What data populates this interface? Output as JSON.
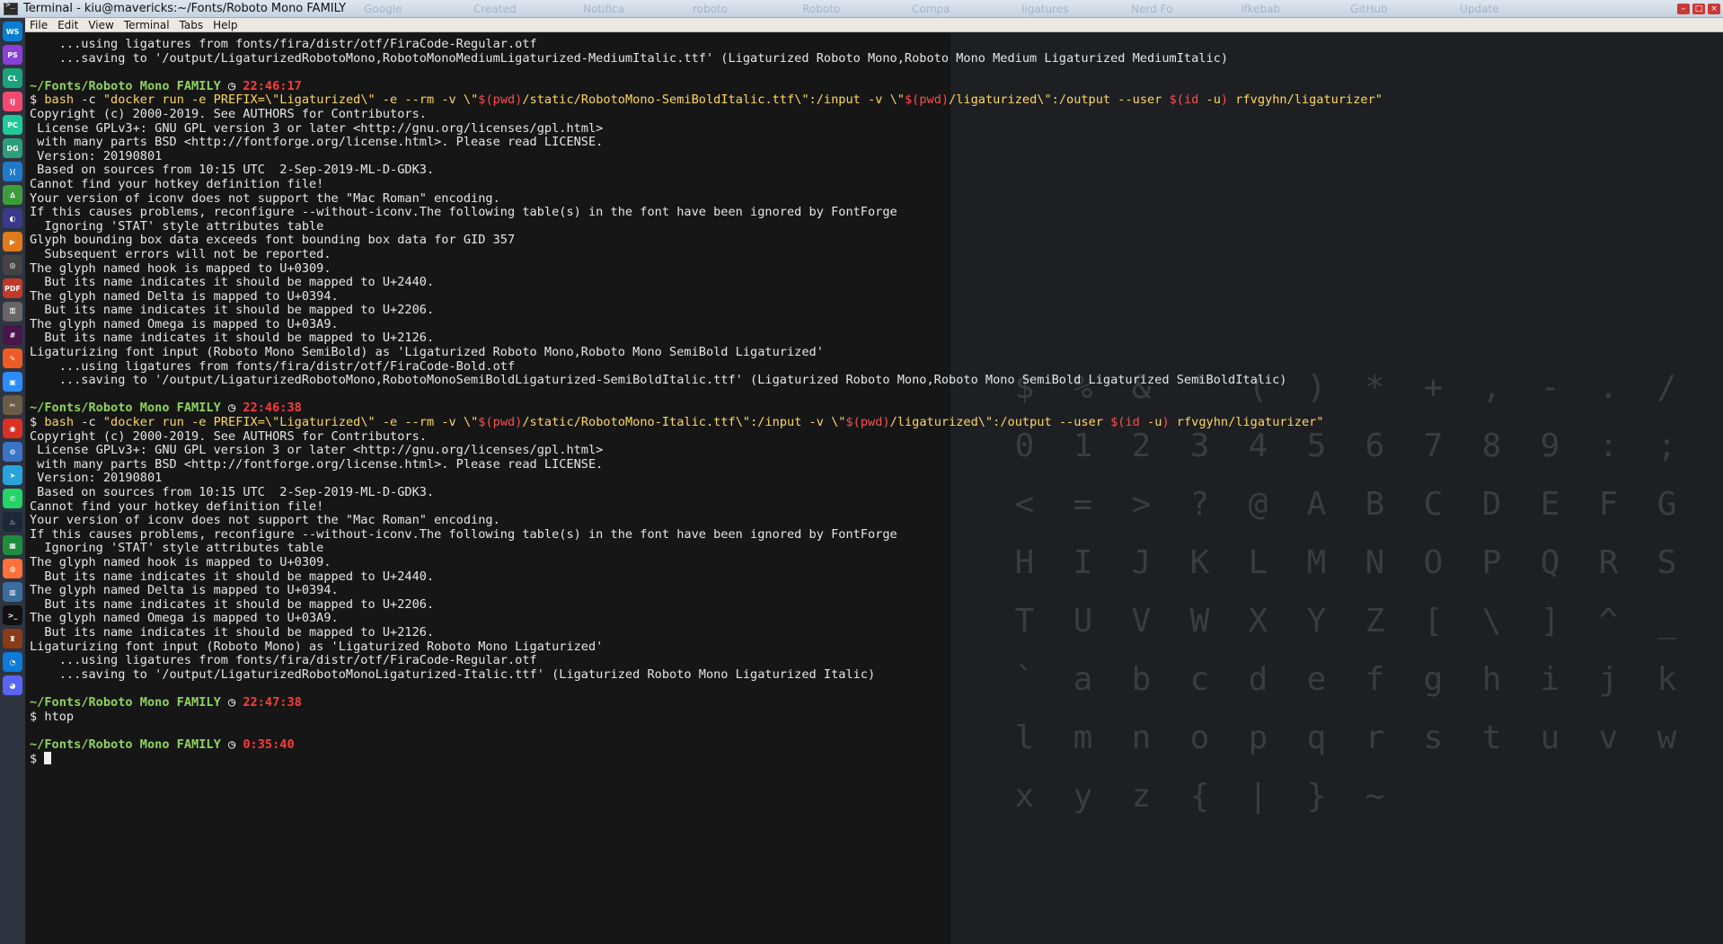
{
  "window": {
    "title": "Terminal - kiu@mavericks:~/Fonts/Roboto Mono FAMILY",
    "background_tabs": [
      "Google",
      "Created",
      "Notifica",
      "roboto",
      "Roboto",
      "Compa",
      "ligatures",
      "Nerd Fo",
      "ifkebab",
      "GitHub",
      "Update"
    ],
    "buttons": [
      "–",
      "□",
      "×"
    ]
  },
  "menu": [
    "File",
    "Edit",
    "View",
    "Terminal",
    "Tabs",
    "Help"
  ],
  "dock": [
    {
      "name": "webstorm",
      "label": "WS",
      "color": "#0b7dd1"
    },
    {
      "name": "phpstorm",
      "label": "PS",
      "color": "#8a3fd8"
    },
    {
      "name": "clion",
      "label": "CL",
      "color": "#1aa37a"
    },
    {
      "name": "intellij",
      "label": "IJ",
      "color": "#f04b6f"
    },
    {
      "name": "pycharm",
      "label": "PC",
      "color": "#20c99a"
    },
    {
      "name": "datagrip",
      "label": "DG",
      "color": "#2c9e7a"
    },
    {
      "name": "vscode",
      "label": "⟩⟨",
      "color": "#1f7ac9"
    },
    {
      "name": "anaconda",
      "label": "∆",
      "color": "#3d9d3d"
    },
    {
      "name": "eclipse",
      "label": "◐",
      "color": "#3a3a8a"
    },
    {
      "name": "player",
      "label": "▶",
      "color": "#e07a1a"
    },
    {
      "name": "obs",
      "label": "◎",
      "color": "#444"
    },
    {
      "name": "pdf",
      "label": "PDF",
      "color": "#c0392b"
    },
    {
      "name": "keyring",
      "label": "⚿",
      "color": "#666"
    },
    {
      "name": "slack",
      "label": "#",
      "color": "#4a154b"
    },
    {
      "name": "postman",
      "label": "✎",
      "color": "#ef5b25"
    },
    {
      "name": "zoom",
      "label": "▣",
      "color": "#2d8cff"
    },
    {
      "name": "gimp",
      "label": "✂",
      "color": "#6a5c45"
    },
    {
      "name": "chrome",
      "label": "◉",
      "color": "#d93025"
    },
    {
      "name": "settings",
      "label": "⚙",
      "color": "#3a74c4"
    },
    {
      "name": "telegram",
      "label": "➤",
      "color": "#2aa3dc"
    },
    {
      "name": "whatsapp",
      "label": "✆",
      "color": "#25d366"
    },
    {
      "name": "steam",
      "label": "♨",
      "color": "#1b2838"
    },
    {
      "name": "sheets",
      "label": "▦",
      "color": "#1e8e3e"
    },
    {
      "name": "firefox",
      "label": "◍",
      "color": "#ff7139"
    },
    {
      "name": "game",
      "label": "▥",
      "color": "#3b6e9c"
    },
    {
      "name": "terminal",
      "label": ">_",
      "color": "#111"
    },
    {
      "name": "game2",
      "label": "♜",
      "color": "#8a3b1a"
    },
    {
      "name": "edge",
      "label": "◔",
      "color": "#0f7ad8"
    },
    {
      "name": "discord",
      "label": "◕",
      "color": "#5865f2"
    }
  ],
  "terminal": {
    "lines": [
      {
        "t": "plain",
        "text": "    ...using ligatures from fonts/fira/distr/otf/FiraCode-Regular.otf"
      },
      {
        "t": "plain",
        "text": "    ...saving to '/output/LigaturizedRobotoMono,RobotoMonoMediumLigaturized-MediumItalic.ttf' (Ligaturized Roboto Mono,Roboto Mono Medium Ligaturized MediumItalic)"
      },
      {
        "t": "blank",
        "text": ""
      },
      {
        "t": "prompt",
        "path": "~/Fonts/Roboto Mono FAMILY",
        "clock": "◷",
        "time": "22:46:17"
      },
      {
        "t": "cmd",
        "prefix": "$ ",
        "bash": "bash",
        "rest1": " -c ",
        "str1": "\"docker run -e PREFIX=\\\"Ligaturized\\\" -e --rm -v \\\"",
        "var1": "$(pwd)",
        "str2": "/static/RobotoMono-SemiBoldItalic.ttf\\\":/input -v \\\"",
        "var2": "$(pwd)",
        "str3": "/ligaturized\\\":/output --user ",
        "var3": "$(id",
        "fl": " -u",
        "var4": ")",
        "str4": " rfvgyhn/ligaturizer\""
      },
      {
        "t": "plain",
        "text": "Copyright (c) 2000-2019. See AUTHORS for Contributors."
      },
      {
        "t": "plain",
        "text": " License GPLv3+: GNU GPL version 3 or later <http://gnu.org/licenses/gpl.html>"
      },
      {
        "t": "plain",
        "text": " with many parts BSD <http://fontforge.org/license.html>. Please read LICENSE."
      },
      {
        "t": "plain",
        "text": " Version: 20190801"
      },
      {
        "t": "plain",
        "text": " Based on sources from 10:15 UTC  2-Sep-2019-ML-D-GDK3."
      },
      {
        "t": "plain",
        "text": "Cannot find your hotkey definition file!"
      },
      {
        "t": "plain",
        "text": "Your version of iconv does not support the \"Mac Roman\" encoding."
      },
      {
        "t": "plain",
        "text": "If this causes problems, reconfigure --without-iconv.The following table(s) in the font have been ignored by FontForge"
      },
      {
        "t": "plain",
        "text": "  Ignoring 'STAT' style attributes table"
      },
      {
        "t": "plain",
        "text": "Glyph bounding box data exceeds font bounding box data for GID 357"
      },
      {
        "t": "plain",
        "text": "  Subsequent errors will not be reported."
      },
      {
        "t": "plain",
        "text": "The glyph named hook is mapped to U+0309."
      },
      {
        "t": "plain",
        "text": "  But its name indicates it should be mapped to U+2440."
      },
      {
        "t": "plain",
        "text": "The glyph named Delta is mapped to U+0394."
      },
      {
        "t": "plain",
        "text": "  But its name indicates it should be mapped to U+2206."
      },
      {
        "t": "plain",
        "text": "The glyph named Omega is mapped to U+03A9."
      },
      {
        "t": "plain",
        "text": "  But its name indicates it should be mapped to U+2126."
      },
      {
        "t": "plain",
        "text": "Ligaturizing font input (Roboto Mono SemiBold) as 'Ligaturized Roboto Mono,Roboto Mono SemiBold Ligaturized'"
      },
      {
        "t": "plain",
        "text": "    ...using ligatures from fonts/fira/distr/otf/FiraCode-Bold.otf"
      },
      {
        "t": "plain",
        "text": "    ...saving to '/output/LigaturizedRobotoMono,RobotoMonoSemiBoldLigaturized-SemiBoldItalic.ttf' (Ligaturized Roboto Mono,Roboto Mono SemiBold Ligaturized SemiBoldItalic)"
      },
      {
        "t": "blank",
        "text": ""
      },
      {
        "t": "prompt",
        "path": "~/Fonts/Roboto Mono FAMILY",
        "clock": "◷",
        "time": "22:46:38"
      },
      {
        "t": "cmd",
        "prefix": "$ ",
        "bash": "bash",
        "rest1": " -c ",
        "str1": "\"docker run -e PREFIX=\\\"Ligaturized\\\" -e --rm -v \\\"",
        "var1": "$(pwd)",
        "str2": "/static/RobotoMono-Italic.ttf\\\":/input -v \\\"",
        "var2": "$(pwd)",
        "str3": "/ligaturized\\\":/output --user ",
        "var3": "$(id",
        "fl": " -u",
        "var4": ")",
        "str4": " rfvgyhn/ligaturizer\""
      },
      {
        "t": "plain",
        "text": "Copyright (c) 2000-2019. See AUTHORS for Contributors."
      },
      {
        "t": "plain",
        "text": " License GPLv3+: GNU GPL version 3 or later <http://gnu.org/licenses/gpl.html>"
      },
      {
        "t": "plain",
        "text": " with many parts BSD <http://fontforge.org/license.html>. Please read LICENSE."
      },
      {
        "t": "plain",
        "text": " Version: 20190801"
      },
      {
        "t": "plain",
        "text": " Based on sources from 10:15 UTC  2-Sep-2019-ML-D-GDK3."
      },
      {
        "t": "plain",
        "text": "Cannot find your hotkey definition file!"
      },
      {
        "t": "plain",
        "text": "Your version of iconv does not support the \"Mac Roman\" encoding."
      },
      {
        "t": "plain",
        "text": "If this causes problems, reconfigure --without-iconv.The following table(s) in the font have been ignored by FontForge"
      },
      {
        "t": "plain",
        "text": "  Ignoring 'STAT' style attributes table"
      },
      {
        "t": "plain",
        "text": "The glyph named hook is mapped to U+0309."
      },
      {
        "t": "plain",
        "text": "  But its name indicates it should be mapped to U+2440."
      },
      {
        "t": "plain",
        "text": "The glyph named Delta is mapped to U+0394."
      },
      {
        "t": "plain",
        "text": "  But its name indicates it should be mapped to U+2206."
      },
      {
        "t": "plain",
        "text": "The glyph named Omega is mapped to U+03A9."
      },
      {
        "t": "plain",
        "text": "  But its name indicates it should be mapped to U+2126."
      },
      {
        "t": "plain",
        "text": "Ligaturizing font input (Roboto Mono) as 'Ligaturized Roboto Mono Ligaturized'"
      },
      {
        "t": "plain",
        "text": "    ...using ligatures from fonts/fira/distr/otf/FiraCode-Regular.otf"
      },
      {
        "t": "plain",
        "text": "    ...saving to '/output/LigaturizedRobotoMonoLigaturized-Italic.ttf' (Ligaturized Roboto Mono Ligaturized Italic)"
      },
      {
        "t": "blank",
        "text": ""
      },
      {
        "t": "prompt",
        "path": "~/Fonts/Roboto Mono FAMILY",
        "clock": "◷",
        "time": "22:47:38"
      },
      {
        "t": "plain",
        "text": "$ htop"
      },
      {
        "t": "blank",
        "text": ""
      },
      {
        "t": "prompt",
        "path": "~/Fonts/Roboto Mono FAMILY",
        "clock": "◷",
        "time": "0:35:40"
      },
      {
        "t": "cursor",
        "text": "$ "
      }
    ]
  },
  "background_glyphs": [
    "$",
    "%",
    "&",
    "'",
    "(",
    ")",
    "*",
    "+",
    ",",
    "-",
    ".",
    "/",
    "0",
    "1",
    "2",
    "3",
    "4",
    "5",
    "6",
    "7",
    "8",
    "9",
    ":",
    ";",
    "<",
    "=",
    ">",
    "?",
    "@",
    "A",
    "B",
    "C",
    "D",
    "E",
    "F",
    "G",
    "H",
    "I",
    "J",
    "K",
    "L",
    "M",
    "N",
    "O",
    "P",
    "Q",
    "R",
    "S",
    "T",
    "U",
    "V",
    "W",
    "X",
    "Y",
    "Z",
    "[",
    "\\",
    "]",
    "^",
    "_",
    "`",
    "a",
    "b",
    "c",
    "d",
    "e",
    "f",
    "g",
    "h",
    "i",
    "j",
    "k",
    "l",
    "m",
    "n",
    "o",
    "p",
    "q",
    "r",
    "s",
    "t",
    "u",
    "v",
    "w",
    "x",
    "y",
    "z",
    "{",
    "|",
    "}",
    "~"
  ]
}
